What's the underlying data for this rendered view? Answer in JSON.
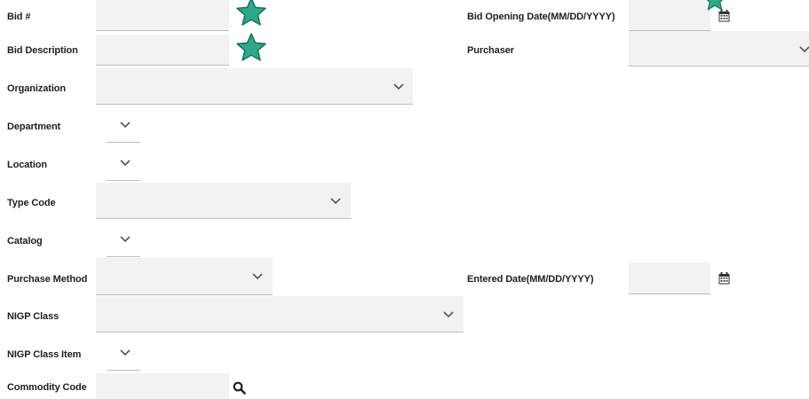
{
  "form": {
    "bid_number_label": "Bid #",
    "bid_description_label": "Bid Description",
    "organization_label": "Organization",
    "department_label": "Department",
    "location_label": "Location",
    "type_code_label": "Type Code",
    "catalog_label": "Catalog",
    "purchase_method_label": "Purchase Method",
    "nigp_class_label": "NIGP Class",
    "nigp_class_item_label": "NIGP Class Item",
    "commodity_code_label": "Commodity Code",
    "bid_opening_date_label": "Bid Opening Date(MM/DD/YYYY)",
    "purchaser_label": "Purchaser",
    "entered_date_label": "Entered Date(MM/DD/YYYY)"
  },
  "values": {
    "bid_number": "",
    "bid_description": "",
    "commodity_code": "",
    "bid_opening_date": "",
    "entered_date": "",
    "organization": "",
    "department": "",
    "location": "",
    "type_code": "",
    "catalog": "",
    "purchase_method": "",
    "nigp_class": "",
    "nigp_class_item": "",
    "purchaser": ""
  },
  "icons": {
    "star": "star-icon",
    "calendar": "calendar-icon",
    "search": "search-icon",
    "chevron": "chevron-down-icon"
  },
  "colors": {
    "star": "#2ea88a",
    "star_stroke": "#16705a",
    "field_bg": "#f2f2f2",
    "field_border": "#bdbdbd",
    "label": "#1f1f1f"
  }
}
